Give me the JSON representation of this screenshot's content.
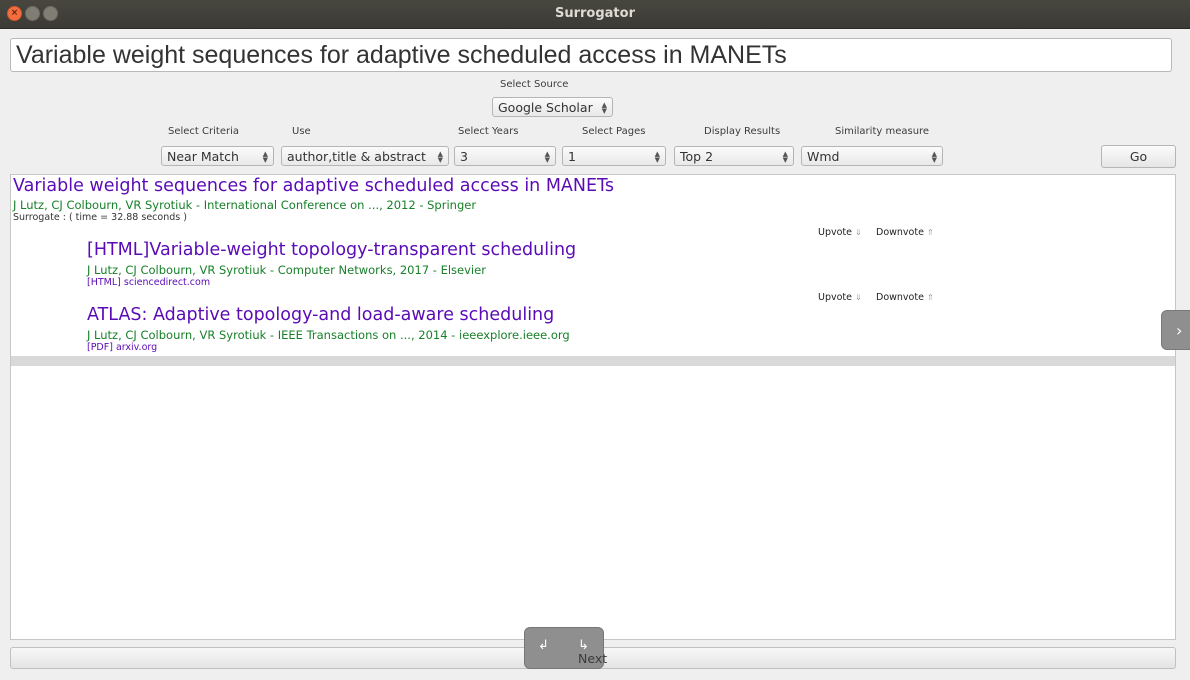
{
  "window": {
    "title": "Surrogator"
  },
  "query": {
    "value": "Variable weight sequences for adaptive scheduled access in MANETs"
  },
  "controls": {
    "source": {
      "label": "Select Source",
      "value": "Google Scholar"
    },
    "criteria": {
      "label": "Select Criteria",
      "value": "Near Match"
    },
    "use": {
      "label": "Use",
      "value": "author,title & abstract"
    },
    "years": {
      "label": "Select Years",
      "value": "3"
    },
    "pages": {
      "label": "Select Pages",
      "value": "1"
    },
    "display": {
      "label": "Display Results",
      "value": "Top 2"
    },
    "similarity": {
      "label": "Similarity measure",
      "value": "Wmd"
    },
    "go_label": "Go"
  },
  "main_result": {
    "title": "Variable weight sequences for adaptive scheduled access in MANETs",
    "authors": "J Lutz, CJ Colbourn, VR Syrotiuk - International Conference on ..., 2012 - Springer",
    "surrogate": "Surrogate :   ( time = 32.88 seconds )"
  },
  "surrogates": [
    {
      "upvote": "Upvote",
      "downvote": "Downvote",
      "title": "[HTML]Variable-weight topology-transparent scheduling",
      "authors": "J Lutz, CJ Colbourn, VR Syrotiuk - Computer Networks, 2017 - Elsevier",
      "link": "[HTML] sciencedirect.com"
    },
    {
      "upvote": "Upvote",
      "downvote": "Downvote",
      "title": "ATLAS: Adaptive topology-and load-aware scheduling",
      "authors": "J Lutz, CJ Colbourn, VR Syrotiuk - IEEE Transactions on ..., 2014 - ieeexplore.ieee.org",
      "link": "[PDF] arxiv.org"
    }
  ],
  "footer": {
    "next_label": "Next"
  },
  "colors": {
    "link_purple": "#5a0bb6",
    "author_green": "#18802a",
    "titlebar": "#3c3b37"
  }
}
